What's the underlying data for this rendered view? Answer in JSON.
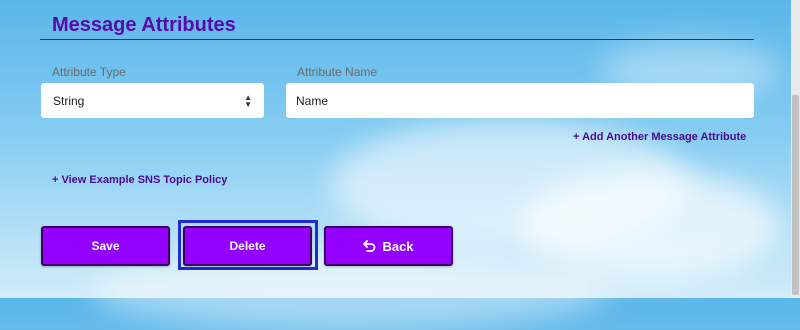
{
  "section": {
    "title": "Message Attributes"
  },
  "attribute_type": {
    "label": "Attribute Type",
    "selected": "String"
  },
  "attribute_name": {
    "label": "Attribute Name",
    "value": "Name"
  },
  "links": {
    "add_attribute": "+ Add Another Message Attribute",
    "view_policy": "+ View Example SNS Topic Policy"
  },
  "buttons": {
    "save": "Save",
    "delete": "Delete",
    "back": "Back"
  },
  "icons": {
    "back": "undo-arrow-icon",
    "select_arrows": "sort-arrows-icon"
  },
  "colors": {
    "heading": "#5a0aa6",
    "button": "#9400ff",
    "focus_ring": "#1e2bd6"
  }
}
